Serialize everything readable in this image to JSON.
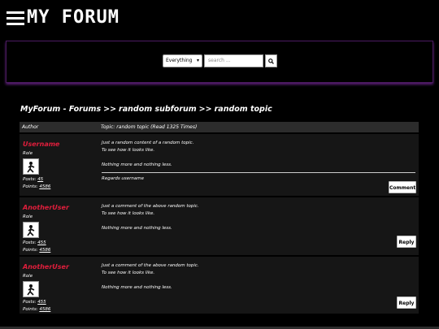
{
  "header": {
    "title": "MY FORUM"
  },
  "search": {
    "scope_value": "Everything",
    "placeholder": "search ...",
    "button_icon": "search-icon"
  },
  "breadcrumb": {
    "items": [
      "MyForum - Forums",
      "random subforum",
      "random topic"
    ],
    "separator": ">>"
  },
  "topic": {
    "col_author": "Author",
    "col_topic": "Topic: random topic  (Read 1325 Times)",
    "posts": [
      {
        "author": "Username",
        "role": "Role",
        "posts_label": "Posts:",
        "posts_value": "45",
        "points_label": "Points:",
        "points_value": "4586",
        "line1": "Just a random content of a random topic.",
        "line2": "To see how it looks like.",
        "line3": "Nothing more and nothing less.",
        "signature": "Regards username",
        "button": "Comment"
      },
      {
        "author": "AnotherUser",
        "role": "Role",
        "posts_label": "Posts:",
        "posts_value": "455",
        "points_label": "Points:",
        "points_value": "4586",
        "line1": "Just a comment of the above random topic.",
        "line2": "To see how it looks like.",
        "line3": "Nothing more and nothing less.",
        "button": "Reply"
      },
      {
        "author": "AnotherUser",
        "role": "Role",
        "posts_label": "Posts:",
        "posts_value": "455",
        "points_label": "Points:",
        "points_value": "4586",
        "line1": "Just a comment of the above random topic.",
        "line2": "To see how it looks like.",
        "line3": "Nothing more and nothing less.",
        "button": "Reply"
      }
    ]
  },
  "colors": {
    "author_name": "#e01e3c",
    "panel_glow": "#5d1f7a",
    "post_bg": "#161616",
    "header_bg": "#2c2c2c"
  }
}
